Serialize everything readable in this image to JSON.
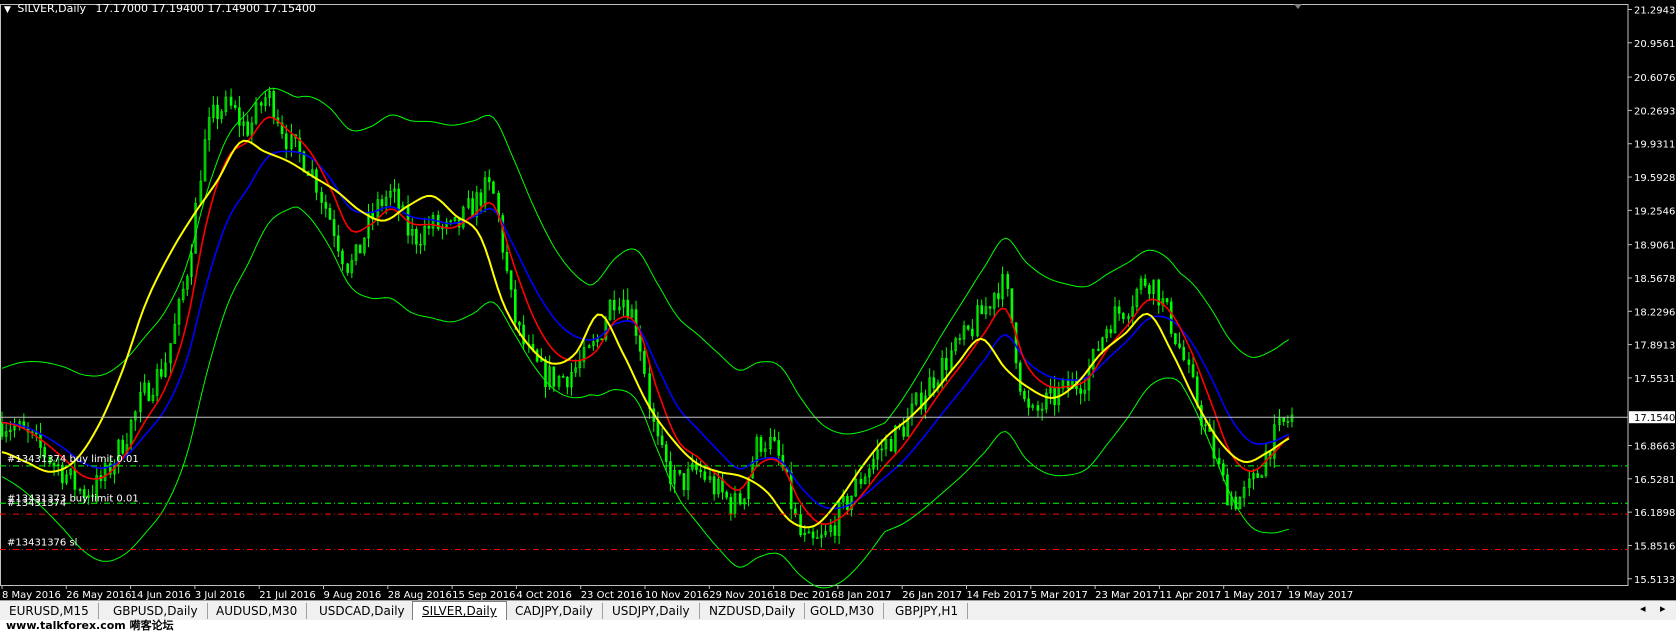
{
  "header": {
    "symbol": "SILVER,Daily",
    "ohlc": "17.17000 17.19400 17.14900 17.15400"
  },
  "order_labels": [
    "#13431374 buy limit 0.01",
    "#13431373 buy limit 0.01",
    "#13431374",
    "#13431376 sl"
  ],
  "current_price_label": "17.15400",
  "colors": {
    "background": "#000000",
    "candles": "#00ff00",
    "bollinger": "#00ff00",
    "ma_red": "#ff0000",
    "ma_blue": "#0000ff",
    "ma_yellow": "#ffff00",
    "axis_text": "#ffffff",
    "buy_limit_line": "#00ff00",
    "sl_line": "#ff0000",
    "price_line": "#c0c0c0"
  },
  "chart_data": {
    "type": "candlestick",
    "symbol": "SILVER",
    "timeframe": "Daily",
    "y_ticks": [
      "21.29435",
      "20.95610",
      "20.60760",
      "20.26935",
      "19.93110",
      "19.59285",
      "19.25460",
      "18.90610",
      "18.56785",
      "18.22960",
      "17.89135",
      "17.55310",
      "16.86635",
      "16.52810",
      "16.18985",
      "15.85160",
      "15.51335"
    ],
    "ylim": [
      15.45,
      21.35
    ],
    "x_ticks": [
      "8 May 2016",
      "26 May 2016",
      "14 Jun 2016",
      "3 Jul 2016",
      "21 Jul 2016",
      "9 Aug 2016",
      "28 Aug 2016",
      "15 Sep 2016",
      "4 Oct 2016",
      "23 Oct 2016",
      "10 Nov 2016",
      "29 Nov 2016",
      "18 Dec 2016",
      "8 Jan 2017",
      "26 Jan 2017",
      "14 Feb 2017",
      "5 Mar 2017",
      "23 Mar 2017",
      "11 Apr 2017",
      "1 May 2017",
      "19 May 2017"
    ],
    "series": [
      {
        "name": "close",
        "values": [
          17.1,
          17.0,
          16.8,
          16.6,
          16.4,
          16.55,
          16.95,
          17.4,
          17.75,
          18.6,
          20.0,
          20.3,
          20.1,
          20.4,
          19.95,
          19.7,
          19.2,
          18.7,
          19.15,
          19.4,
          19.0,
          19.1,
          19.05,
          19.3,
          19.4,
          18.2,
          17.7,
          17.55,
          17.65,
          17.9,
          18.4,
          18.05,
          16.9,
          16.5,
          16.6,
          16.4,
          16.3,
          16.9,
          16.7,
          15.95,
          15.9,
          16.2,
          16.55,
          16.85,
          17.05,
          17.4,
          17.7,
          17.95,
          18.25,
          18.45,
          17.25,
          17.3,
          17.45,
          17.6,
          18.1,
          18.3,
          18.55,
          18.15,
          17.55,
          16.9,
          16.35,
          16.45,
          16.9,
          17.15
        ]
      },
      {
        "name": "",
        "values": [
          16.8,
          16.7,
          16.6,
          16.7,
          17.05,
          17.6,
          18.3,
          18.8,
          19.2,
          19.55,
          19.95,
          19.85,
          19.75,
          19.6,
          19.45,
          19.25,
          19.15,
          19.3,
          19.4,
          19.2,
          19.0,
          18.3,
          17.9,
          17.7,
          17.8,
          18.2,
          17.8,
          17.3,
          16.95,
          16.7,
          16.6,
          16.55,
          16.4,
          16.1,
          16.05,
          16.3,
          16.65,
          16.95,
          17.15,
          17.4,
          17.7,
          17.95,
          17.65,
          17.45,
          17.35,
          17.5,
          17.8,
          18.0,
          18.2,
          17.8,
          17.3,
          16.9,
          16.7,
          16.8,
          16.95
        ]
      }
    ],
    "grid": false,
    "price_lines": {
      "current": 17.154,
      "buy_limit_1": 16.66,
      "buy_limit_2": 16.28,
      "pending": 16.17,
      "stop_loss": 15.81
    }
  },
  "tabs": [
    "EURUSD,M15",
    "GBPUSD,Daily",
    "AUDUSD,M30",
    "USDCAD,Daily",
    "SILVER,Daily",
    "CADJPY,Daily",
    "USDJPY,Daily",
    "NZDUSD,Daily",
    "GOLD,M30",
    "GBPJPY,H1"
  ],
  "active_tab": "SILVER,Daily",
  "footer": {
    "watermark": "www.talkforex.com 嗬客论坛"
  }
}
